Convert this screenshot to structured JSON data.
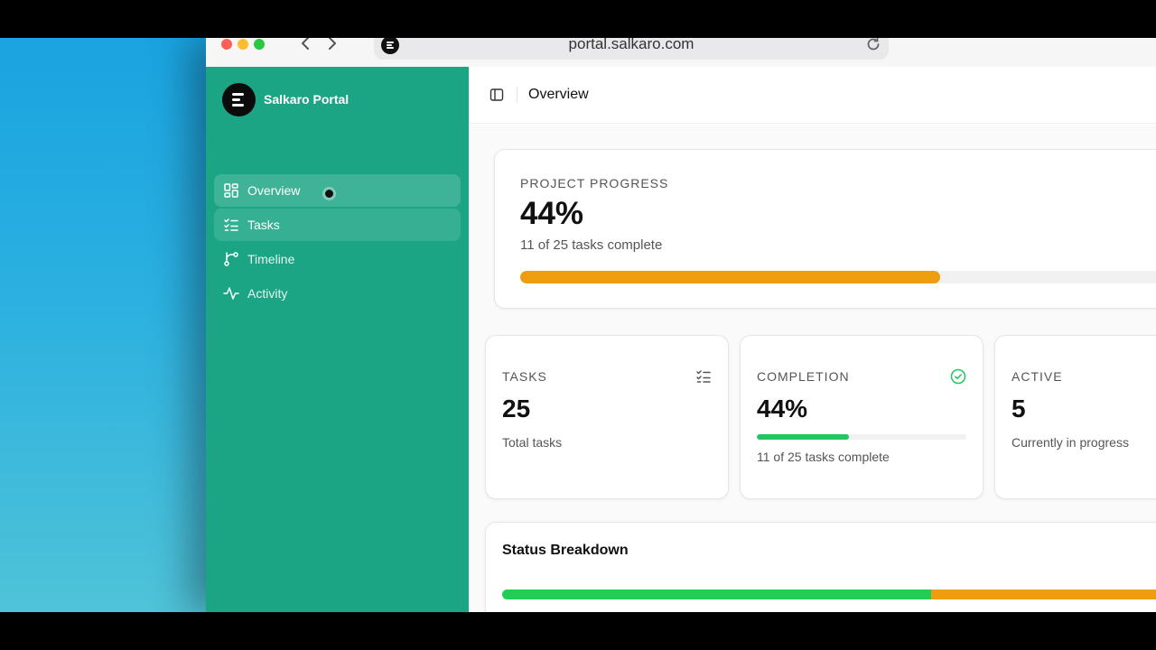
{
  "browser": {
    "url": "portal.salkaro.com"
  },
  "sidebar": {
    "brand": "Salkaro Portal",
    "items": [
      {
        "label": "Overview",
        "icon": "dashboard-icon",
        "state": "active"
      },
      {
        "label": "Tasks",
        "icon": "checklist-icon",
        "state": "hover"
      },
      {
        "label": "Timeline",
        "icon": "git-branch-icon",
        "state": "normal"
      },
      {
        "label": "Activity",
        "icon": "activity-icon",
        "state": "normal"
      }
    ]
  },
  "header": {
    "title": "Overview"
  },
  "project_progress": {
    "label": "PROJECT PROGRESS",
    "value": "44%",
    "subtitle": "11 of 25 tasks complete",
    "bar_fraction": 0.646,
    "bar_color": "#ee9d0f"
  },
  "stats": [
    {
      "label": "TASKS",
      "value": "25",
      "subtitle": "Total tasks",
      "icon": "checklist-icon"
    },
    {
      "label": "COMPLETION",
      "value": "44%",
      "subtitle": "11 of 25 tasks complete",
      "icon": "check-circle-icon",
      "bar_fraction": 0.44,
      "bar_color": "#22c55e"
    },
    {
      "label": "ACTIVE",
      "value": "5",
      "subtitle": "Currently in progress"
    }
  ],
  "status_breakdown": {
    "title": "Status Breakdown",
    "segments": [
      {
        "fraction": 0.64,
        "color": "#22cc55"
      },
      {
        "fraction": 0.36,
        "color": "#ee9d0f"
      }
    ]
  },
  "colors": {
    "sidebar": "#1ba585",
    "accent_amber": "#ee9d0f",
    "accent_green": "#22c55e"
  }
}
